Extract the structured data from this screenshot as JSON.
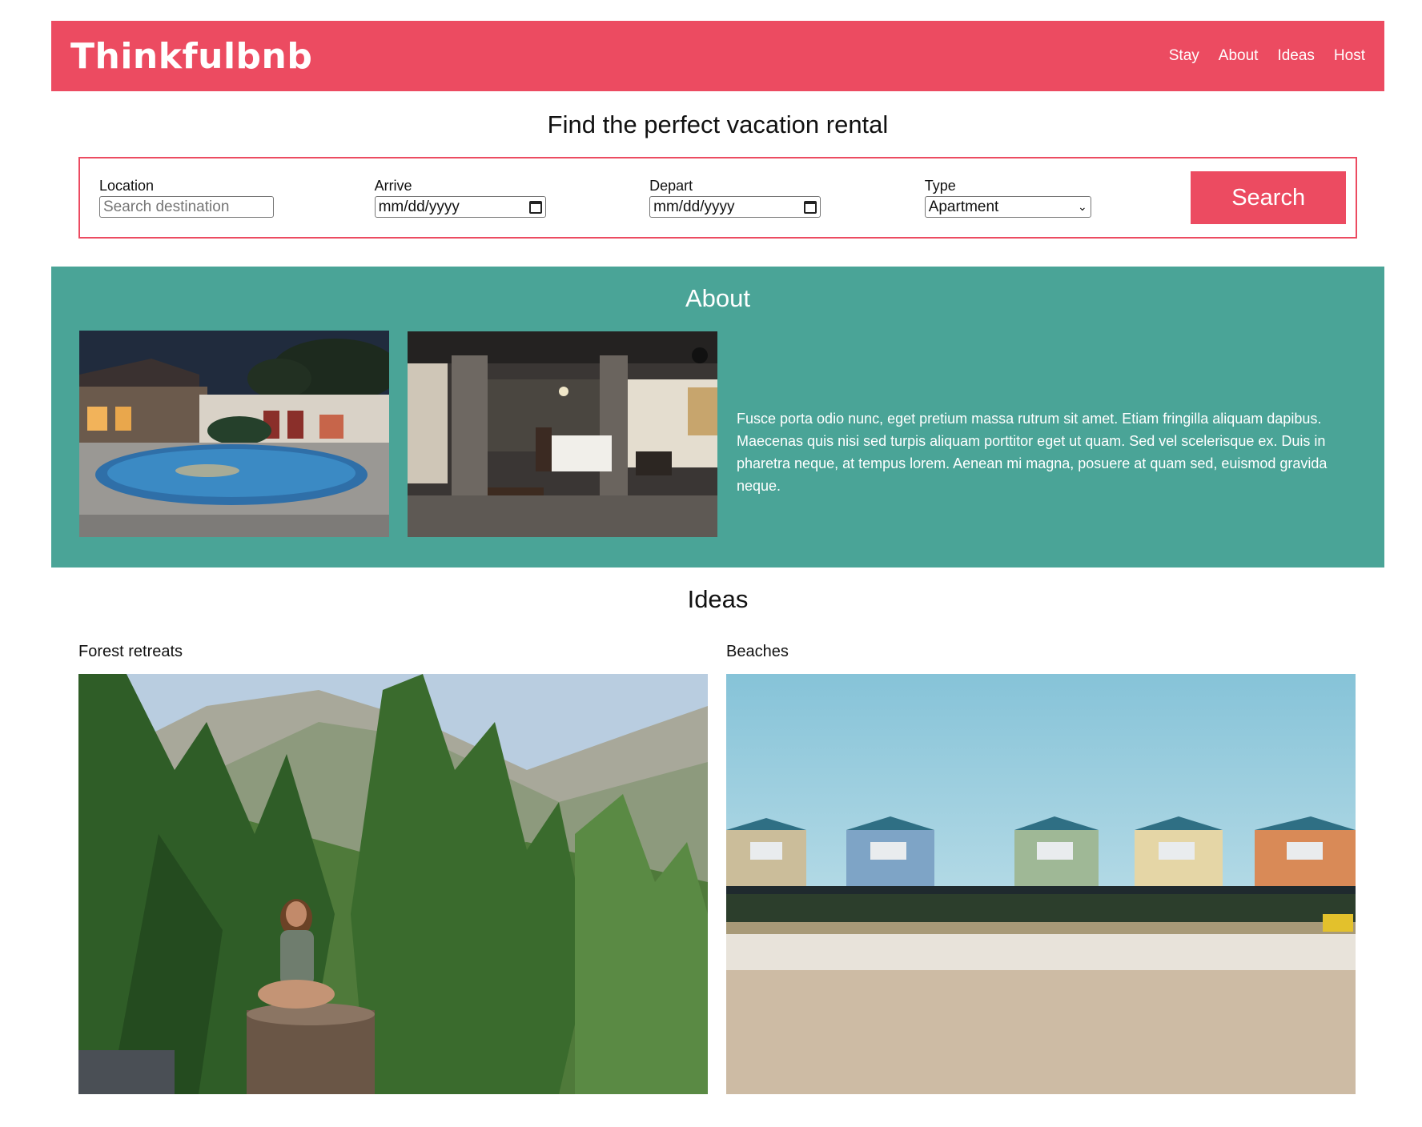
{
  "header": {
    "logo": "Thinkfulbnb",
    "nav": [
      "Stay",
      "About",
      "Ideas",
      "Host"
    ]
  },
  "find": {
    "title": "Find the perfect vacation rental",
    "location_label": "Location",
    "location_placeholder": "Search destination",
    "arrive_label": "Arrive",
    "arrive_value": "mm/dd/yyyy",
    "depart_label": "Depart",
    "depart_value": "mm/dd/yyyy",
    "type_label": "Type",
    "type_value": "Apartment",
    "search_button": "Search"
  },
  "about": {
    "title": "About",
    "text": "Fusce porta odio nunc, eget pretium massa rutrum sit amet. Etiam fringilla aliquam dapibus. Maecenas quis nisi sed turpis aliquam porttitor eget ut quam. Sed vel scelerisque ex. Duis in pharetra neque, at tempus lorem. Aenean mi magna, posuere at quam sed, euismod gravida neque."
  },
  "ideas": {
    "title": "Ideas",
    "items": [
      {
        "label": "Forest retreats"
      },
      {
        "label": "Beaches"
      }
    ]
  },
  "colors": {
    "brand": "#ec4b61",
    "about_bg": "#4aa497"
  }
}
